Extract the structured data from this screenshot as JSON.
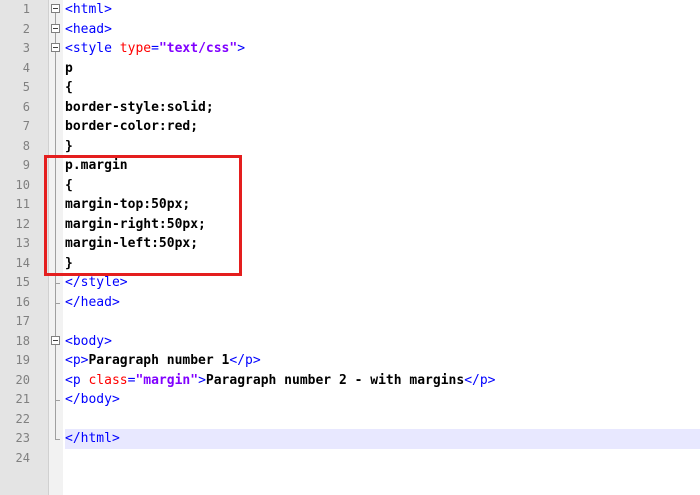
{
  "editor": {
    "lines": [
      {
        "n": "1",
        "fold": "box",
        "segs": [
          {
            "c": "tag",
            "t": "<html>"
          }
        ]
      },
      {
        "n": "2",
        "fold": "box",
        "segs": [
          {
            "c": "tag",
            "t": "<head>"
          }
        ]
      },
      {
        "n": "3",
        "fold": "box",
        "segs": [
          {
            "c": "tag",
            "t": "<style "
          },
          {
            "c": "attr",
            "t": "type"
          },
          {
            "c": "tag",
            "t": "="
          },
          {
            "c": "str",
            "t": "\"text/css\""
          },
          {
            "c": "tag",
            "t": ">"
          }
        ]
      },
      {
        "n": "4",
        "fold": "line",
        "segs": [
          {
            "c": "css",
            "t": "p"
          }
        ]
      },
      {
        "n": "5",
        "fold": "line",
        "segs": [
          {
            "c": "css",
            "t": "{"
          }
        ]
      },
      {
        "n": "6",
        "fold": "line",
        "segs": [
          {
            "c": "css",
            "t": "border-style:solid;"
          }
        ]
      },
      {
        "n": "7",
        "fold": "line",
        "segs": [
          {
            "c": "css",
            "t": "border-color:red;"
          }
        ]
      },
      {
        "n": "8",
        "fold": "line",
        "segs": [
          {
            "c": "css",
            "t": "}"
          }
        ]
      },
      {
        "n": "9",
        "fold": "line",
        "segs": [
          {
            "c": "css",
            "t": "p.margin"
          }
        ]
      },
      {
        "n": "10",
        "fold": "line",
        "segs": [
          {
            "c": "css",
            "t": "{"
          }
        ]
      },
      {
        "n": "11",
        "fold": "line",
        "segs": [
          {
            "c": "css",
            "t": "margin-top:50px;"
          }
        ]
      },
      {
        "n": "12",
        "fold": "line",
        "segs": [
          {
            "c": "css",
            "t": "margin-right:50px;"
          }
        ]
      },
      {
        "n": "13",
        "fold": "line",
        "segs": [
          {
            "c": "css",
            "t": "margin-left:50px;"
          }
        ]
      },
      {
        "n": "14",
        "fold": "line",
        "segs": [
          {
            "c": "css",
            "t": "}"
          }
        ]
      },
      {
        "n": "15",
        "fold": "end",
        "segs": [
          {
            "c": "tag",
            "t": "</style>"
          }
        ]
      },
      {
        "n": "16",
        "fold": "end",
        "segs": [
          {
            "c": "tag",
            "t": "</head>"
          }
        ]
      },
      {
        "n": "17",
        "fold": "line",
        "segs": []
      },
      {
        "n": "18",
        "fold": "box",
        "segs": [
          {
            "c": "tag",
            "t": "<body>"
          }
        ]
      },
      {
        "n": "19",
        "fold": "line",
        "segs": [
          {
            "c": "tag",
            "t": "<p>"
          },
          {
            "c": "txt",
            "t": "Paragraph number 1"
          },
          {
            "c": "tag",
            "t": "</p>"
          }
        ]
      },
      {
        "n": "20",
        "fold": "line",
        "segs": [
          {
            "c": "tag",
            "t": "<p "
          },
          {
            "c": "attr",
            "t": "class"
          },
          {
            "c": "tag",
            "t": "="
          },
          {
            "c": "str",
            "t": "\"margin\""
          },
          {
            "c": "tag",
            "t": ">"
          },
          {
            "c": "txt",
            "t": "Paragraph number 2 - with margins"
          },
          {
            "c": "tag",
            "t": "</p>"
          }
        ]
      },
      {
        "n": "21",
        "fold": "end",
        "segs": [
          {
            "c": "tag",
            "t": "</body>"
          }
        ]
      },
      {
        "n": "22",
        "fold": "line",
        "segs": []
      },
      {
        "n": "23",
        "fold": "end",
        "current": true,
        "segs": [
          {
            "c": "tag",
            "t": "</html>"
          }
        ]
      },
      {
        "n": "24",
        "fold": "none",
        "segs": []
      }
    ]
  },
  "colors": {
    "tag": "#0000ff",
    "attr": "#ff0000",
    "string": "#8000ff",
    "text": "#000000",
    "highlight_box": "#e41e1e",
    "current_line": "#e8e8ff"
  }
}
